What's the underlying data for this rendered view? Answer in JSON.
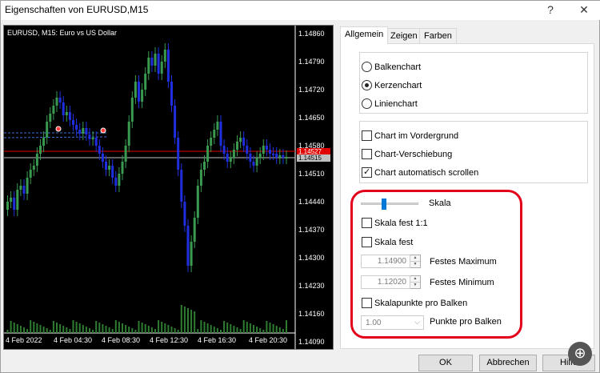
{
  "window": {
    "title": "Eigenschaften von EURUSD,M15",
    "help_glyph": "?",
    "close_glyph": "✕"
  },
  "chart": {
    "symbol_label": "EURUSD, M15:  Euro vs US Dollar",
    "price_labels": [
      "1.14860",
      "1.14790",
      "1.14720",
      "1.14650",
      "1.14580",
      "1.14510",
      "1.14440",
      "1.14370",
      "1.14300",
      "1.14230",
      "1.14160",
      "1.14090"
    ],
    "current_price": "1.14515",
    "ask_price": "1.14527",
    "time_labels": [
      "4 Feb 2022",
      "4 Feb 04:30",
      "4 Feb 08:30",
      "4 Feb 12:30",
      "4 Feb 16:30",
      "4 Feb 20:30"
    ],
    "colors": {
      "background": "#000000",
      "bull": "#3a9a4f",
      "bear": "#1f2fe0",
      "bid_line": "#c0c0c0",
      "ask_line": "#e00000",
      "volume": "#2e7d32",
      "trade_line": "#3b6fd6"
    }
  },
  "tabs": [
    {
      "label": "Allgemein",
      "active": true
    },
    {
      "label": "Zeigen",
      "active": false
    },
    {
      "label": "Farben",
      "active": false
    }
  ],
  "chart_type": {
    "options": [
      {
        "label": "Balkenchart",
        "checked": false
      },
      {
        "label": "Kerzenchart",
        "checked": true
      },
      {
        "label": "Linienchart",
        "checked": false
      }
    ]
  },
  "chart_options": {
    "items": [
      {
        "label": "Chart im Vordergrund",
        "checked": false
      },
      {
        "label": "Chart-Verschiebung",
        "checked": false
      },
      {
        "label": "Chart automatisch scrollen",
        "checked": true
      }
    ]
  },
  "scale": {
    "slider_label": "Skala",
    "fixed_1_1_label": "Skala fest 1:1",
    "fixed_1_1_checked": false,
    "fixed_label": "Skala fest",
    "fixed_checked": false,
    "max_value": "1.14900",
    "max_label": "Festes Maximum",
    "min_value": "1.12020",
    "min_label": "Festes Minimum",
    "points_per_bar_label": "Skalapunkte pro Balken",
    "points_per_bar_checked": false,
    "points_value": "1.00",
    "points_label": "Punkte pro Balken"
  },
  "buttons": {
    "ok": "OK",
    "cancel": "Abbrechen",
    "help": "Hilfe"
  }
}
